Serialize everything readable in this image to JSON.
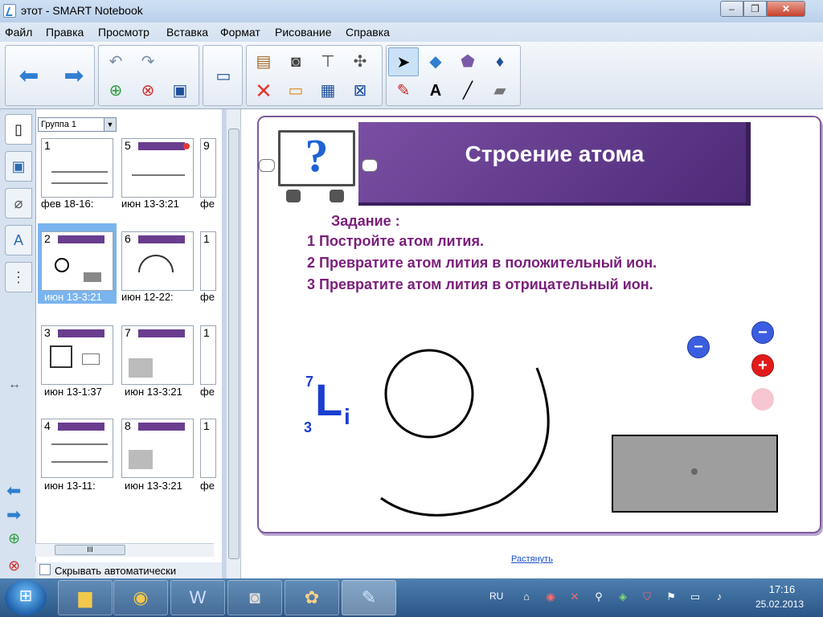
{
  "window": {
    "title": "этот - SMART Notebook",
    "min": "‒",
    "max": "❐",
    "close": "✕"
  },
  "menu": [
    "Файл",
    "Правка",
    "Просмотр",
    "Вставка",
    "Формат",
    "Рисование",
    "Справка"
  ],
  "toolbar": {
    "icons": [
      "back-arrow-icon",
      "forward-arrow-icon",
      "undo-icon",
      "redo-icon",
      "add-page-icon",
      "delete-page-icon",
      "save-icon",
      "screen-display-icon",
      "paste-icon",
      "camera-icon",
      "document-camera-icon",
      "measure-tools-icon",
      "delete-icon",
      "screen-shade-icon",
      "table-icon",
      "full-screen-icon",
      "select-arrow-icon",
      "shapes-icon",
      "magic-pen-icon",
      "fill-icon",
      "pens-icon",
      "text-icon",
      "line-icon",
      "eraser-icon"
    ],
    "accent": "#2f7fd0"
  },
  "sidebar": {
    "group_label": "Группа 1",
    "auto_hide": "Скрывать автоматически",
    "thumbnails": [
      {
        "num": "1",
        "caption": "фев  18-16:"
      },
      {
        "num": "5",
        "caption": "июн  13-3:21"
      },
      {
        "num": "9",
        "caption": "фе"
      },
      {
        "num": "2",
        "caption": "июн  13-3:21"
      },
      {
        "num": "6",
        "caption": "июн  12-22:"
      },
      {
        "num": "1",
        "caption": "фе"
      },
      {
        "num": "3",
        "caption": "июн  13-1:37"
      },
      {
        "num": "7",
        "caption": "июн  13-3:21"
      },
      {
        "num": "1",
        "caption": "фе"
      },
      {
        "num": "4",
        "caption": "июн  13-11:"
      },
      {
        "num": "8",
        "caption": "июн  13-3:21"
      },
      {
        "num": "1",
        "caption": "фе"
      }
    ],
    "scroll_label": "III"
  },
  "slide": {
    "title": "Строение атома",
    "task_head": "Задание :",
    "tasks": [
      "1 Постройте атом лития.",
      "2 Превратите атом лития в положительный ион.",
      "3 Превратите атом лития в отрицательный ион."
    ],
    "mass_number": "7",
    "atomic_number": "3",
    "symbol_L": "L",
    "symbol_i": "i",
    "electron_sign": "−",
    "proton_sign": "+",
    "stretch_link": "Растянуть",
    "colors": {
      "title_band": "#5e3589",
      "task_text": "#7a1f7a",
      "element": "#1a3fd1",
      "electron": "#3b5de0",
      "proton": "#e21a1a",
      "neutron": "#f6c6d0"
    }
  },
  "taskbar": {
    "apps": [
      "explorer-icon",
      "chrome-icon",
      "word-icon",
      "document-camera-app-icon",
      "paint-icon",
      "smart-notebook-icon"
    ],
    "lang": "RU",
    "time": "17:16",
    "date": "25.02.2013"
  }
}
